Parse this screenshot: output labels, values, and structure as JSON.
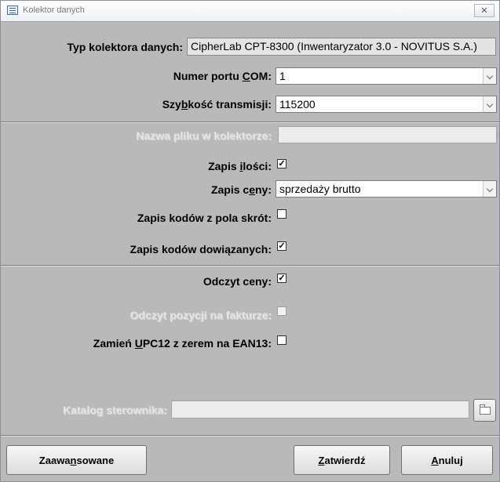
{
  "window": {
    "title": "Kolektor danych",
    "close_label": "✕"
  },
  "form": {
    "typ_label": "Typ kolektora danych:",
    "typ_value": "CipherLab CPT-8300 (Inwentaryzator 3.0 - NOVITUS S.A.)",
    "port_label_pre": "Numer portu ",
    "port_label_key": "C",
    "port_label_post": "OM:",
    "port_value": "1",
    "speed_label_pre": "Szy",
    "speed_label_key": "b",
    "speed_label_post": "kość transmisji:",
    "speed_value": "115200",
    "file_label": "Nazwa pliku w kolektorze:",
    "file_value": "",
    "qty_label_pre": "Zapis ",
    "qty_label_key": "i",
    "qty_label_post": "lości:",
    "qty_checked": true,
    "price_label_pre": "Zapis c",
    "price_label_key": "e",
    "price_label_post": "ny:",
    "price_value": "sprzedaży brutto",
    "short_codes_label": "Zapis kodów z pola skrót:",
    "short_codes_checked": false,
    "linked_codes_label": "Zapis kodów dowiązanych:",
    "linked_codes_checked": true,
    "read_price_label": "Odczyt ceny:",
    "read_price_checked": true,
    "read_invoice_label": "Odczyt pozycji na fakturze:",
    "read_invoice_checked": false,
    "upc_label_pre": "Zamień ",
    "upc_label_key": "U",
    "upc_label_post": "PC12 z zerem na EAN13:",
    "upc_checked": false,
    "catalog_label": "Katalog sterownika:",
    "catalog_value": ""
  },
  "buttons": {
    "advanced_pre": "Zaawa",
    "advanced_key": "n",
    "advanced_post": "sowane",
    "confirm_key": "Z",
    "confirm_post": "atwierdź",
    "cancel_key": "A",
    "cancel_post": "nuluj"
  },
  "icons": {
    "browse": "folder-icon",
    "app": "form-icon",
    "close": "close-icon",
    "dropdown": "chevron-down-icon"
  }
}
